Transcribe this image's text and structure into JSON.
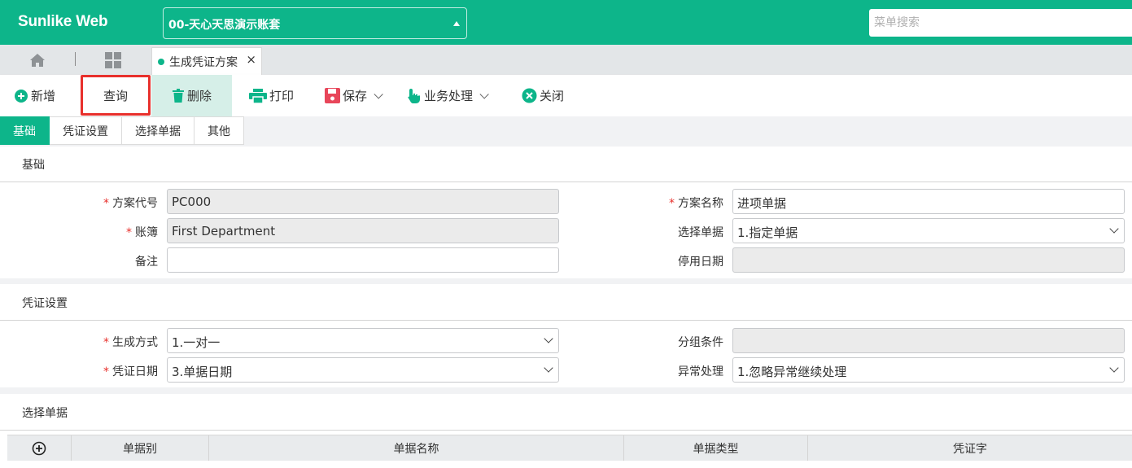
{
  "app": {
    "brand": "Sunlike Web",
    "account_selector": "00-天心天思演示账套",
    "menu_search_placeholder": "菜单搜索"
  },
  "tabs": {
    "open_tab_label": "生成凭证方案",
    "close_glyph": "×"
  },
  "toolbar": {
    "add": "新增",
    "query": "查询",
    "delete": "删除",
    "print": "打印",
    "save": "保存",
    "business": "业务处理",
    "close": "关闭"
  },
  "subtabs": [
    "基础",
    "凭证设置",
    "选择单据",
    "其他"
  ],
  "sections": {
    "basic": {
      "title": "基础",
      "scheme_code_label": "方案代号",
      "scheme_code_value": "PC000",
      "scheme_name_label": "方案名称",
      "scheme_name_value": "进项单据",
      "ledger_label": "账簿",
      "ledger_value": "First Department",
      "select_doc_label": "选择单据",
      "select_doc_value": "1.指定单据",
      "remark_label": "备注",
      "remark_value": "",
      "disable_date_label": "停用日期",
      "disable_date_value": ""
    },
    "voucher": {
      "title": "凭证设置",
      "gen_mode_label": "生成方式",
      "gen_mode_value": "1.一对一",
      "group_cond_label": "分组条件",
      "group_cond_value": "",
      "voucher_date_label": "凭证日期",
      "voucher_date_value": "3.单据日期",
      "exception_label": "异常处理",
      "exception_value": "1.忽略异常继续处理"
    },
    "docs": {
      "title": "选择单据",
      "columns": [
        "单据别",
        "单据名称",
        "单据类型",
        "凭证字"
      ]
    }
  },
  "required_mark": "*",
  "colors": {
    "brand_green": "#0db58a",
    "highlight_red": "#e8302c",
    "delete_bg": "#d6efe8"
  }
}
